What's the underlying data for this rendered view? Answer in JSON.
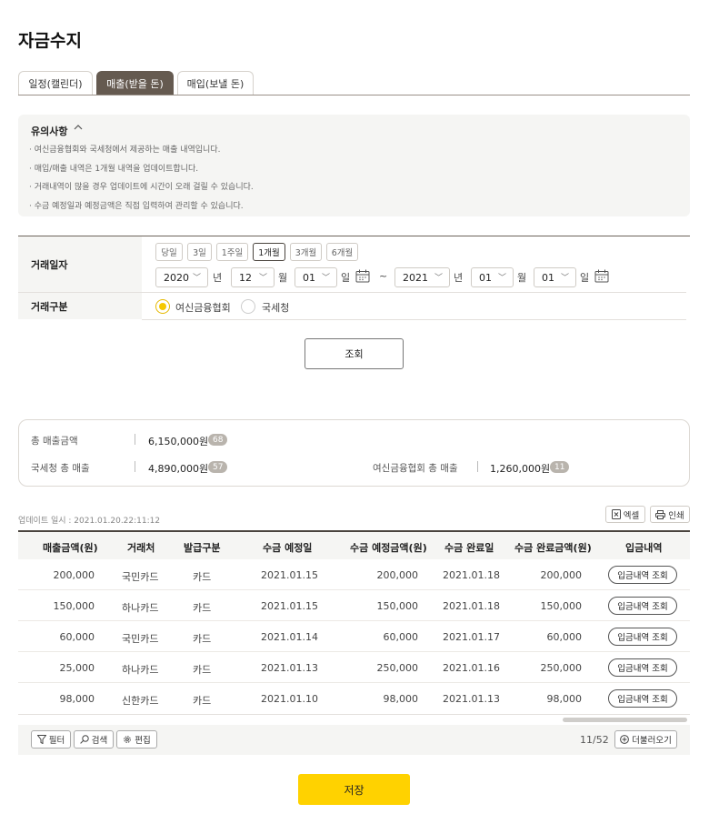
{
  "page": {
    "title": "자금수지"
  },
  "tabs": [
    {
      "label": "일정(캘린더)",
      "active": false
    },
    {
      "label": "매출(받을 돈)",
      "active": true
    },
    {
      "label": "매입(보낼 돈)",
      "active": false
    }
  ],
  "notice": {
    "title": "유의사항",
    "lines": [
      "· 여신금융협회와 국세청에서 제공하는 매출 내역입니다.",
      "· 매입/매출 내역은 1개월 내역을 업데이트합니다.",
      "· 거래내역이 많을 경우 업데이트에 시간이 오래 걸릴 수 있습니다.",
      "· 수금 예정일과 예정금액은 직접 입력하여 관리할 수 있습니다."
    ]
  },
  "filter": {
    "date_label": "거래일자",
    "quick_periods": [
      "당일",
      "3일",
      "1주일",
      "1개월",
      "3개월",
      "6개월"
    ],
    "selected_period": "1개월",
    "from": {
      "year": "2020",
      "month": "12",
      "day": "01"
    },
    "to": {
      "year": "2021",
      "month": "01",
      "day": "01"
    },
    "units": {
      "year": "년",
      "month": "월",
      "day": "일",
      "tilde": "~"
    },
    "type_label": "거래구분",
    "type_options": [
      "여신금융협회",
      "국세청"
    ],
    "type_selected": "여신금융협회",
    "search_label": "조회"
  },
  "summary": {
    "total_label": "총 매출금액",
    "total_value": "6,150,000원",
    "total_count": "68",
    "nts_label": "국세청 총 매출",
    "nts_value": "4,890,000원",
    "nts_count": "57",
    "card_label": "여신금융협회 총 매출",
    "card_value": "1,260,000원",
    "card_count": "11"
  },
  "toolbar": {
    "update_time": "업데이트 일시 : 2021.01.20.22:11:12",
    "excel_label": "엑셀",
    "print_label": "인쇄"
  },
  "table": {
    "headers": [
      "매출금액(원)",
      "거래처",
      "발급구분",
      "수금 예정일",
      "수금 예정금액(원)",
      "수금 완료일",
      "수금 완료금액(원)",
      "입금내역"
    ],
    "rows": [
      {
        "amount": "200,000",
        "client": "국민카드",
        "type": "카드",
        "due_date": "2021.01.15",
        "due_amount": "200,000",
        "done_date": "2021.01.18",
        "done_amount": "200,000",
        "action": "입금내역 조회"
      },
      {
        "amount": "150,000",
        "client": "하나카드",
        "type": "카드",
        "due_date": "2021.01.15",
        "due_amount": "150,000",
        "done_date": "2021.01.18",
        "done_amount": "150,000",
        "action": "입금내역 조회"
      },
      {
        "amount": "60,000",
        "client": "국민카드",
        "type": "카드",
        "due_date": "2021.01.14",
        "due_amount": "60,000",
        "done_date": "2021.01.17",
        "done_amount": "60,000",
        "action": "입금내역 조회"
      },
      {
        "amount": "25,000",
        "client": "하나카드",
        "type": "카드",
        "due_date": "2021.01.13",
        "due_amount": "250,000",
        "done_date": "2021.01.16",
        "done_amount": "250,000",
        "action": "입금내역 조회"
      },
      {
        "amount": "98,000",
        "client": "신한카드",
        "type": "카드",
        "due_date": "2021.01.10",
        "due_amount": "98,000",
        "done_date": "2021.01.13",
        "done_amount": "98,000",
        "action": "입금내역 조회"
      }
    ]
  },
  "footer": {
    "filter_label": "필터",
    "search_label": "검색",
    "edit_label": "편집",
    "page_count": "11/52",
    "more_label": "더불러오기"
  },
  "save_label": "저장",
  "colors": {
    "accent": "#ffd200",
    "tab_active": "#655a50",
    "radio_on": "#f5c800"
  }
}
